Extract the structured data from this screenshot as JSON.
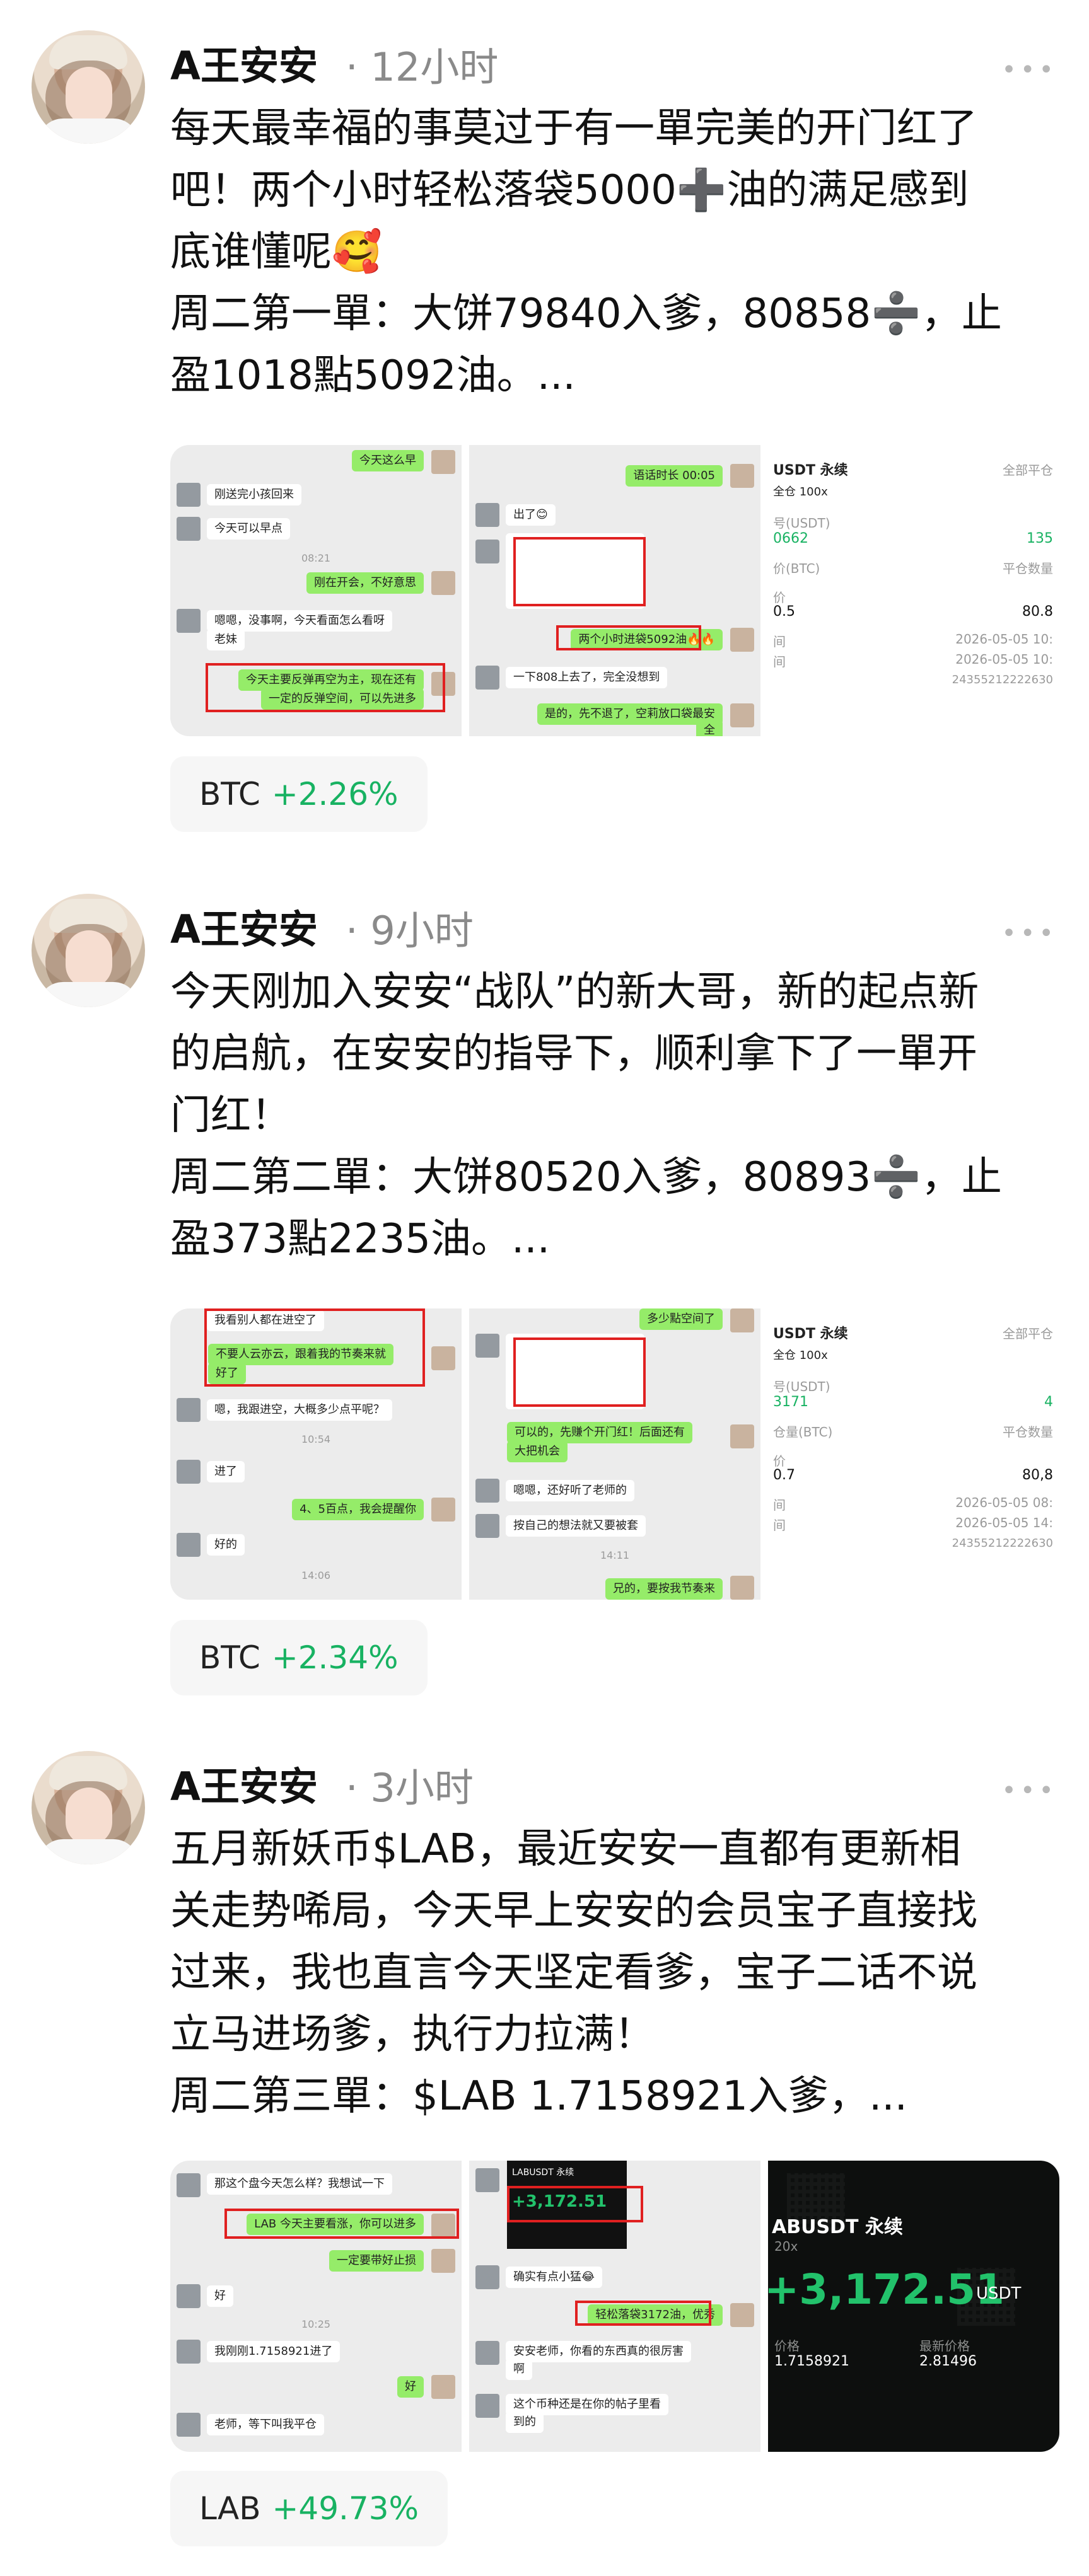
{
  "posts": [
    {
      "author": "A王安安",
      "time": "12小时",
      "more": "•••",
      "lines": [
        "每天最幸福的事莫过于有一單完美的开门红了",
        "吧！两个小时轻松落袋5000➕油的满足感到",
        "底谁懂呢🥰",
        "周二第一單：大饼79840入爹，80858➗，止",
        "盈1018點5092油。..."
      ],
      "chat1": {
        "b1": "今天这么早",
        "b2": "刚送完小孩回来",
        "b3": "今天可以早点",
        "t1": "08:21",
        "b4": "刚在开会，不好意思",
        "b5": "嗯嗯，没事啊，今天看面怎么看呀",
        "b6": "老妹",
        "b7": "今天主要反弹再空为主，现在还有",
        "b8": "一定的反弹空间，可以先进多"
      },
      "chat2": {
        "b1": "语话时长 00:05",
        "b2": "出了😊",
        "b3": "两个小时进袋5092油🔥🔥",
        "b4": "一下808上去了，完全没想到",
        "b5": "是的，先不退了，空莉放口袋最安",
        "b6": "全"
      },
      "card": {
        "title": "USDT 永续",
        "mode": "全仓 100x",
        "right_title": "全部平仓",
        "r1_label": "号(USDT)",
        "r1_left": "0662",
        "r1_right": "135",
        "r2_label": "价(BTC)",
        "r2_right": "平仓数量",
        "r3_label": "价",
        "r3_left": "0.5",
        "r3_right": "80.8",
        "r4_label": "间",
        "r4_right": "2026-05-05 10:",
        "r5_label": "间",
        "r5_right": "2026-05-05 10:",
        "id": "24355212222630"
      },
      "tag": {
        "symbol": "BTC",
        "change": "+2.26%"
      }
    },
    {
      "author": "A王安安",
      "time": "9小时",
      "more": "•••",
      "lines": [
        "今天刚加入安安“战队”的新大哥，新的起点新",
        "的启航，在安安的指导下，顺利拿下了一單开",
        "门红！",
        "周二第二單：大饼80520入爹，80893➗，止",
        "盈373點2235油。..."
      ],
      "chat1": {
        "b1": "我看别人都在进空了",
        "b2": "不要人云亦云，跟着我的节奏来就",
        "b3": "好了",
        "b4": "嗯，我跟进空，大概多少点平呢？",
        "t1": "10:54",
        "b5": "进了",
        "b6": "4、5百点，我会提醒你",
        "b7": "好的",
        "t2": "14:06"
      },
      "chat2": {
        "b1": "多少點空间了",
        "b2": "可以的，先赚个开门红！后面还有",
        "b3": "大把机会",
        "b4": "嗯嗯，还好听了老师的",
        "b5": "按自己的想法就又要被套",
        "t1": "14:11",
        "b6": "兄的，要按我节奏来"
      },
      "card": {
        "title": "USDT 永续",
        "mode": "全仓 100x",
        "right_title": "全部平仓",
        "r1_label": "号(USDT)",
        "r1_left": "3171",
        "r1_right": "4",
        "r2_label": "仓量(BTC)",
        "r2_right": "平仓数量",
        "r3_label": "价",
        "r3_left": "0.7",
        "r3_right": "80,8",
        "r4_label": "间",
        "r4_right": "2026-05-05 08:",
        "r5_label": "间",
        "r5_right": "2026-05-05 14:",
        "id": "24355212222630"
      },
      "tag": {
        "symbol": "BTC",
        "change": "+2.34%"
      }
    },
    {
      "author": "A王安安",
      "time": "3小时",
      "more": "•••",
      "lines": [
        "五月新妖币$LAB，最近安安一直都有更新相",
        "关走势唏局，今天早上安安的会员宝子直接找",
        "过来，我也直言今天坚定看爹，宝子二话不说",
        "立马进场爹，执行力拉满！",
        "周二第三單：$LAB 1.7158921入爹，..."
      ],
      "chat1": {
        "b1": "那这个盘今天怎么样？我想试一下",
        "b2": "LAB 今天主要看涨，你可以进多",
        "b3": "一定要带好止损",
        "b4": "好",
        "t1": "10:25",
        "b5": "我刚刚1.7158921进了",
        "b6": "好",
        "b7": "老师，等下叫我平仓"
      },
      "chat2": {
        "b1": "LABUSDT 永续",
        "b2": "+3,172.51",
        "b3": "确实有点小猛😂",
        "b4": "轻松落袋3172油，优秀",
        "b5": "安安老师，你看的东西真的很厉害",
        "b6": "啊",
        "b7": "这个币种还是在你的帖子里看",
        "b8": "到的"
      },
      "dark": {
        "title": "ABUSDT 永续",
        "mode": "20x",
        "pnl": "+3,172.51",
        "unit": "USDT",
        "l1": "价格",
        "l1v": "1.7158921",
        "l2": "最新价格",
        "l2v": "2.81496"
      },
      "tag": {
        "symbol": "LAB",
        "change": "+49.73%"
      }
    }
  ]
}
